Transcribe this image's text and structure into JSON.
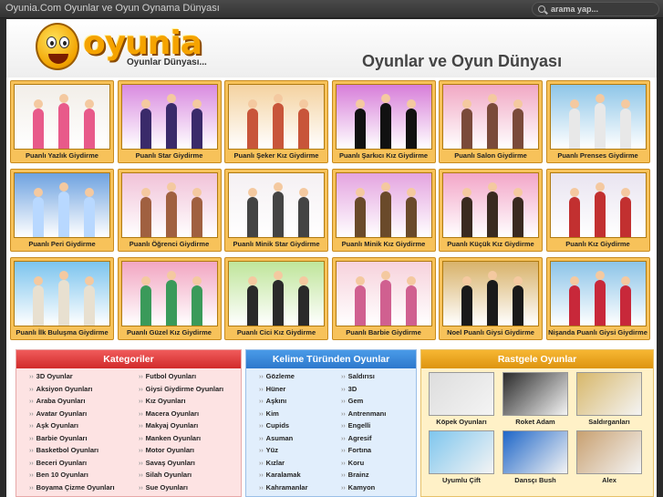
{
  "topbar": {
    "site_title": "Oyunia.Com Oyunlar ve Oyun Oynama Dünyası",
    "search_placeholder": "arama yap..."
  },
  "header": {
    "logo_text": "oyunia",
    "logo_tagline": "Oyunlar Dünyası...",
    "headline": "Oyunlar ve Oyun Dünyası"
  },
  "games": [
    {
      "title": "Puanlı Yazlık Giydirme",
      "bg": "#f2eee8",
      "accent": "#e85a8a"
    },
    {
      "title": "Puanlı Star Giydirme",
      "bg": "#d98be0",
      "accent": "#3a2a6a"
    },
    {
      "title": "Puanlı Şeker Kız Giydirme",
      "bg": "#f4d2a0",
      "accent": "#c8553a"
    },
    {
      "title": "Puanlı Şarkıcı Kız Giydirme",
      "bg": "#d77ed9",
      "accent": "#111111"
    },
    {
      "title": "Puanlı Salon Giydirme",
      "bg": "#f1a8c4",
      "accent": "#7a4a3a"
    },
    {
      "title": "Puanlı Prenses Giydirme",
      "bg": "#8ec6e8",
      "accent": "#e8e8e8"
    },
    {
      "title": "Puanlı Peri Giydirme",
      "bg": "#6ea2e0",
      "accent": "#b8d8ff"
    },
    {
      "title": "Puanlı Öğrenci Giydirme",
      "bg": "#f1c2d8",
      "accent": "#a06040"
    },
    {
      "title": "Puanlı Minik Star Giydirme",
      "bg": "#f5f0f3",
      "accent": "#444444"
    },
    {
      "title": "Puanlı Minik Kız Giydirme",
      "bg": "#e4a4e0",
      "accent": "#6a4a2a"
    },
    {
      "title": "Puanlı Küçük Kız Giydirme",
      "bg": "#f3a6c8",
      "accent": "#3a2a20"
    },
    {
      "title": "Puanlı Kız Giydirme",
      "bg": "#e9e4f0",
      "accent": "#c23030"
    },
    {
      "title": "Puanlı İlk Buluşma Giydirme",
      "bg": "#7cc4ee",
      "accent": "#e8e0d0"
    },
    {
      "title": "Puanlı Güzel Kız Giydirme",
      "bg": "#f2a6c2",
      "accent": "#3a9a5a"
    },
    {
      "title": "Puanlı Cici Kız Giydirme",
      "bg": "#bfe59a",
      "accent": "#2a2a2a"
    },
    {
      "title": "Puanlı Barbie Giydirme",
      "bg": "#f7d2dc",
      "accent": "#d06090"
    },
    {
      "title": "Noel Puanlı Giysi Giydirme",
      "bg": "#d8b26a",
      "accent": "#1a1a1a"
    },
    {
      "title": "Nişanda Puanlı Giysi Giydirme",
      "bg": "#8cc4e8",
      "accent": "#c8283a"
    }
  ],
  "categories": {
    "title": "Kategoriler",
    "left": [
      "3D Oyunlar",
      "Aksiyon Oyunları",
      "Araba Oyunları",
      "Avatar Oyunları",
      "Aşk Oyunları",
      "Barbie Oyunları",
      "Basketbol Oyunları",
      "Beceri Oyunları",
      "Ben 10 Oyunları",
      "Boyama Çizme Oyunları"
    ],
    "right": [
      "Futbol Oyunları",
      "Giysi Giydirme Oyunları",
      "Kız Oyunları",
      "Macera Oyunları",
      "Makyaj Oyunları",
      "Manken Oyunları",
      "Motor Oyunları",
      "Savaş Oyunları",
      "Silah Oyunları",
      "Sue Oyunları"
    ]
  },
  "keywords": {
    "title": "Kelime Türünden Oyunlar",
    "left": [
      "Gözleme",
      "Hüner",
      "Aşkını",
      "Kim",
      "Cupids",
      "Asuman",
      "Yüz",
      "Kızlar",
      "Karalamak",
      "Kahramanlar"
    ],
    "right": [
      "Saldırısı",
      "3D",
      "Gem",
      "Antrenmanı",
      "Engelli",
      "Agresif",
      "Fortına",
      "Koru",
      "Brainz",
      "Kamyon"
    ]
  },
  "random": {
    "title": "Rastgele Oyunlar",
    "items": [
      {
        "title": "Köpek Oyunları",
        "bg": "#dddddd"
      },
      {
        "title": "Roket Adam",
        "bg": "#2a2a2a"
      },
      {
        "title": "Saldırganları",
        "bg": "#d7b76a"
      },
      {
        "title": "Uyumlu Çift",
        "bg": "#7fc6ee"
      },
      {
        "title": "Dansçı Bush",
        "bg": "#1e66c8"
      },
      {
        "title": "Alex",
        "bg": "#c8a070"
      }
    ]
  },
  "colors": {
    "orange_card": "#f7c25a",
    "categories_header": "#e03a3a",
    "keywords_header": "#3b8ae0",
    "random_header": "#f0a020"
  }
}
